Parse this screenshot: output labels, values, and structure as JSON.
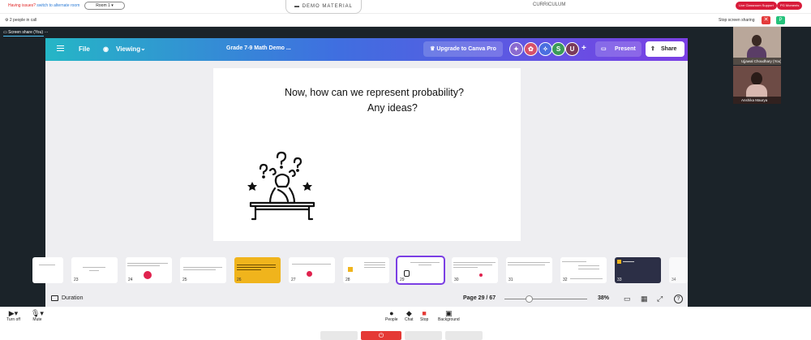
{
  "topbar": {
    "issue_text": "Having issues?",
    "switch_link": "switch to alternate room",
    "room_label": "Room 1",
    "demo_material": "DEMO MATERIAL",
    "curriculum": "CURRICULUM",
    "live_support": "Live Classroom Support",
    "pg_moments": "PG Moments"
  },
  "callbar": {
    "people_in_call": "2 people in call",
    "stop_sharing": "Stop screen sharing",
    "p_badge": "P"
  },
  "screenshare": {
    "label": "Screen share (You)",
    "more": "···"
  },
  "canva": {
    "file": "File",
    "viewing": "Viewing",
    "doc_title": "Grade 7-9 Math Demo ...",
    "upgrade": "Upgrade to Canva Pro",
    "avatar_s": "S",
    "avatar_u": "U",
    "present": "Present",
    "share": "Share",
    "duration": "Duration",
    "page_indicator": "Page 29 / 67",
    "zoom": "38%",
    "zoom_level": 0.3,
    "help": "?"
  },
  "slide": {
    "line1": "Now, how can we represent probability?",
    "line2": "Any ideas?"
  },
  "thumbnails": [
    "23",
    "24",
    "25",
    "26",
    "27",
    "28",
    "29",
    "30",
    "31",
    "32",
    "33",
    "34"
  ],
  "participants": [
    {
      "name": "Ujjawal Choudhary (You)"
    },
    {
      "name": "Anshika Maurya"
    }
  ],
  "toolbar": {
    "turn_off": "Turn off",
    "mute": "Mute",
    "people": "People",
    "chat": "Chat",
    "stop": "Stop",
    "background": "Background"
  }
}
